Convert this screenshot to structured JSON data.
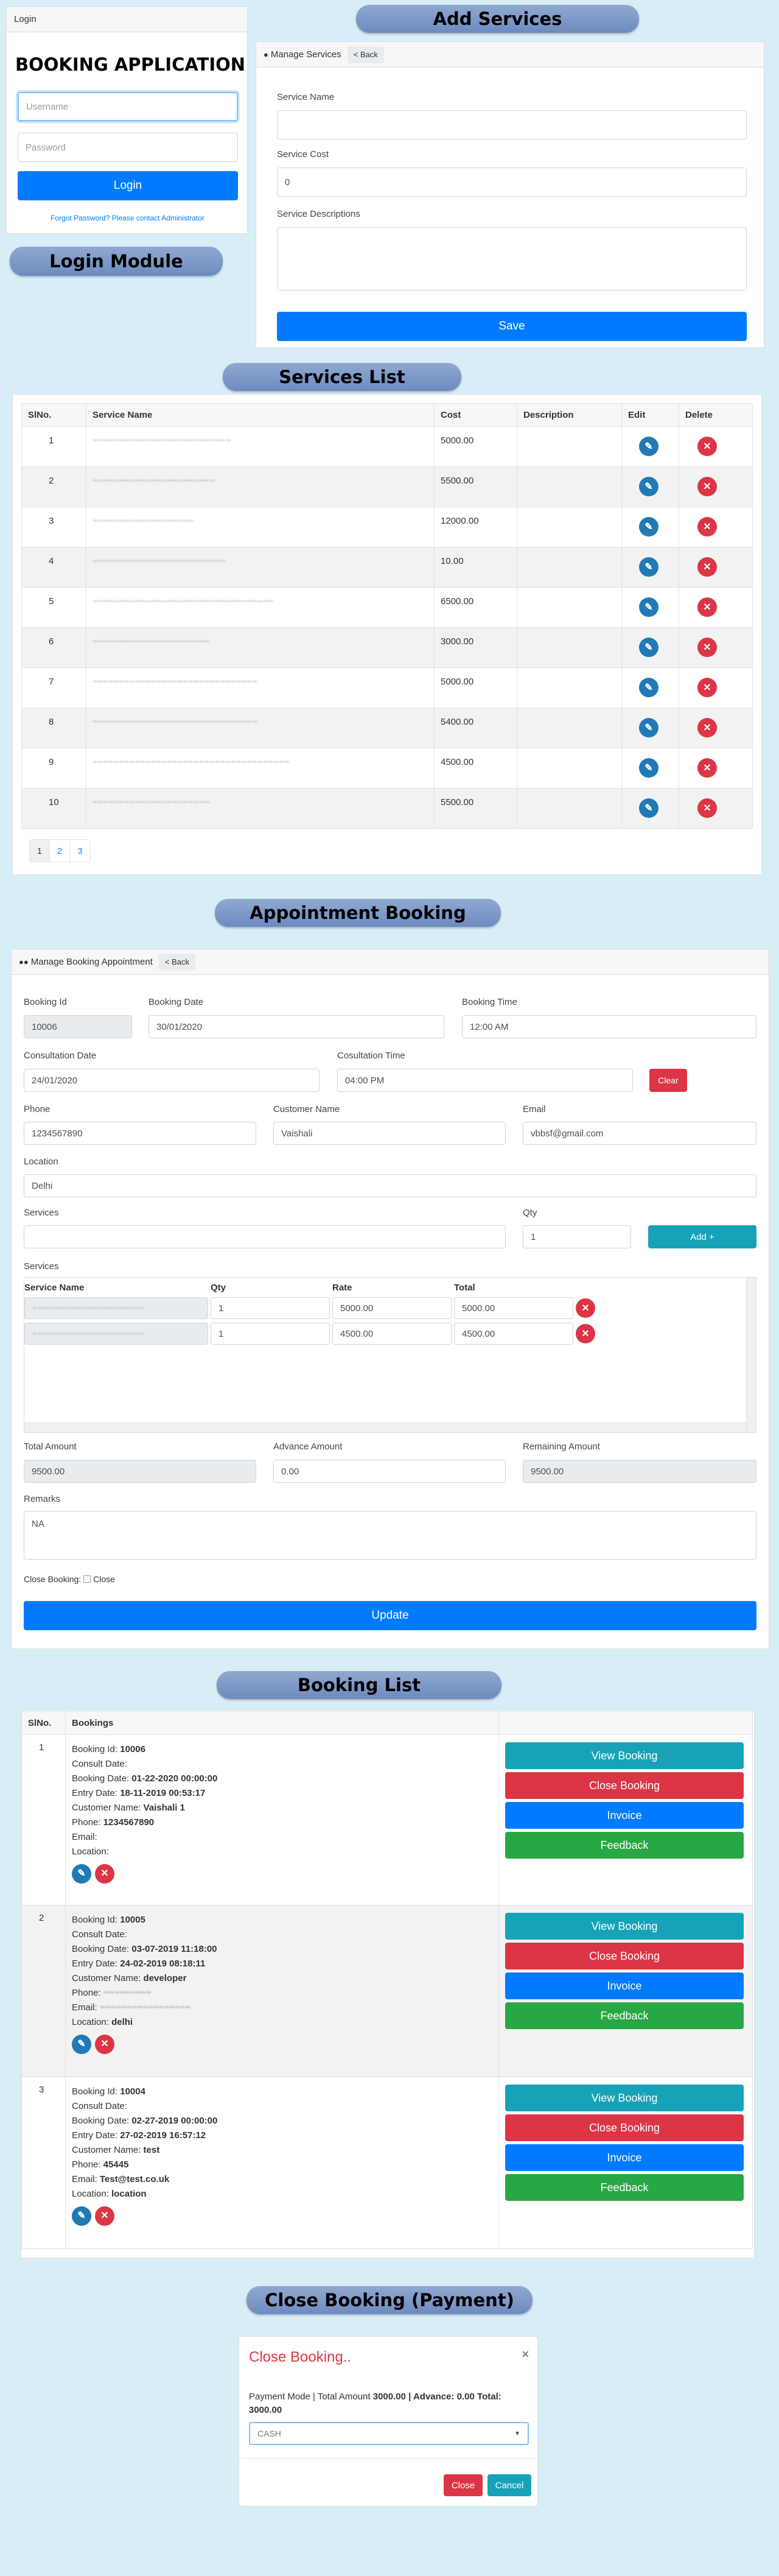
{
  "login": {
    "header": "Login",
    "title": "BOOKING APPLICATION",
    "username_placeholder": "Username",
    "password_placeholder": "Password",
    "login_label": "Login",
    "forgot": "Forgot Password? Please contact Administrator"
  },
  "labels": {
    "add_services": "Add Services",
    "login_module": "Login Module",
    "services_list": "Services List",
    "appointment_booking": "Appointment Booking",
    "booking_list": "Booking List",
    "close_booking": "Close Booking (Payment)"
  },
  "add_service": {
    "header": "Manage Services",
    "back": "< Back",
    "name_label": "Service Name",
    "cost_label": "Service Cost",
    "cost_value": "0",
    "desc_label": "Service Descriptions",
    "save": "Save"
  },
  "services": {
    "columns": [
      "SlNo.",
      "Service Name",
      "Cost",
      "Description",
      "Edit",
      "Delete"
    ],
    "rows": [
      {
        "no": "1",
        "name": "~~~~~~~~~~~~~~~~~~~~~~~~~~",
        "cost": "5000.00"
      },
      {
        "no": "2",
        "name": "~~~~~~~~~~~~~~~~~~~~~~~",
        "cost": "5500.00"
      },
      {
        "no": "3",
        "name": "~~~~~~~~~~~~~~~~~~~",
        "cost": "12000.00"
      },
      {
        "no": "4",
        "name": "~~~~~~~~~~~~~~~~~~~~~~~~~",
        "cost": "10.00"
      },
      {
        "no": "5",
        "name": "~~~~~~~~~~~~~~~~~~~~~~~~~~~~~~~~~~",
        "cost": "6500.00"
      },
      {
        "no": "6",
        "name": "~~~~~~~~~~~~~~~~~~~~~~",
        "cost": "3000.00"
      },
      {
        "no": "7",
        "name": "~~~~~~~~~~~~~~~~~~~~~~~~~~~~~~~",
        "cost": "5000.00"
      },
      {
        "no": "8",
        "name": "~~~~~~~~~~~~~~~~~~~~~~~~~~~~~~~",
        "cost": "5400.00"
      },
      {
        "no": "9",
        "name": "~~~~~~~~~~~~~~~~~~~~~~~~~~~~~~~~~~~~~",
        "cost": "4500.00"
      },
      {
        "no": "10",
        "name": "~~~~~~~~~~~~~~~~~~~~~~",
        "cost": "5500.00"
      }
    ],
    "pages": [
      "1",
      "2",
      "3"
    ]
  },
  "appointment": {
    "header": "Manage Booking Appointment",
    "back": "< Back",
    "booking_id_label": "Booking Id",
    "booking_id": "10006",
    "booking_date_label": "Booking Date",
    "booking_date": "30/01/2020",
    "booking_time_label": "Booking Time",
    "booking_time": "12:00 AM",
    "consult_date_label": "Consultation Date",
    "consult_date": "24/01/2020",
    "consult_time_label": "Cosultation Time",
    "consult_time": "04:00 PM",
    "clear": "Clear",
    "phone_label": "Phone",
    "phone": "1234567890",
    "customer_label": "Customer Name",
    "customer": "Vaishali",
    "email_label": "Email",
    "email": "vbbsf@gmail.com",
    "location_label": "Location",
    "location": "Delhi",
    "services_label": "Services",
    "qty_label": "Qty",
    "qty": "1",
    "add": "Add +",
    "services_table_label": "Services",
    "sv_columns": [
      "Service Name",
      "Qty",
      "Rate",
      "Total"
    ],
    "sv_rows": [
      {
        "name": "~~~~~~~~~~~~~~~~~~~~~",
        "qty": "1",
        "rate": "5000.00",
        "total": "5000.00"
      },
      {
        "name": "~~~~~~~~~~~~~~~~~~~~~",
        "qty": "1",
        "rate": "4500.00",
        "total": "4500.00"
      }
    ],
    "total_label": "Total Amount",
    "total": "9500.00",
    "advance_label": "Advance Amount",
    "advance": "0.00",
    "remaining_label": "Remaining Amount",
    "remaining": "9500.00",
    "remarks_label": "Remarks",
    "remarks": "NA",
    "close_booking_label": "Close Booking:",
    "close_check_label": "Close",
    "update": "Update"
  },
  "bookings": {
    "columns": [
      "SlNo.",
      "Bookings"
    ],
    "actions": {
      "view": "View Booking",
      "close": "Close Booking",
      "invoice": "Invoice",
      "feedback": "Feedback"
    },
    "rows": [
      {
        "no": "1",
        "id": "10006",
        "consult": "",
        "booking_date": "01-22-2020 00:00:00",
        "entry_date": "18-11-2019 00:53:17",
        "customer": "Vaishali 1",
        "phone": "1234567890",
        "email": "",
        "location": ""
      },
      {
        "no": "2",
        "id": "10005",
        "consult": "",
        "booking_date": "03-07-2019 11:18:00",
        "entry_date": "24-02-2019 08:18:11",
        "customer": "developer",
        "phone": "~~~~~~~~~",
        "email": "~~~~~~~~~~~~~~~~~",
        "location": "delhi"
      },
      {
        "no": "3",
        "id": "10004",
        "consult": "",
        "booking_date": "02-27-2019 00:00:00",
        "entry_date": "27-02-2019 16:57:12",
        "customer": "test",
        "phone": "45445",
        "email": "Test@test.co.uk",
        "location": "location"
      }
    ],
    "field_labels": {
      "id": "Booking Id:",
      "consult": "Consult Date:",
      "booking_date": "Booking Date:",
      "entry_date": "Entry Date:",
      "customer": "Customer Name:",
      "phone": "Phone:",
      "email": "Email:",
      "location": "Location:"
    }
  },
  "modal": {
    "title": "Close Booking..",
    "close_x": "×",
    "line_pre": "Payment Mode | Total Amount",
    "total": "3000.00",
    "advance_label": "| Advance:",
    "advance": "0.00",
    "total_label": "Total:",
    "total2": "3000.00",
    "mode": "CASH",
    "close_btn": "Close",
    "cancel_btn": "Cancel"
  },
  "colors": {
    "primary": "#007bff",
    "danger": "#dc3545",
    "info": "#17a2b8",
    "success": "#28a745",
    "background": "#d8eef7",
    "label_pill": "#7b98c9"
  }
}
